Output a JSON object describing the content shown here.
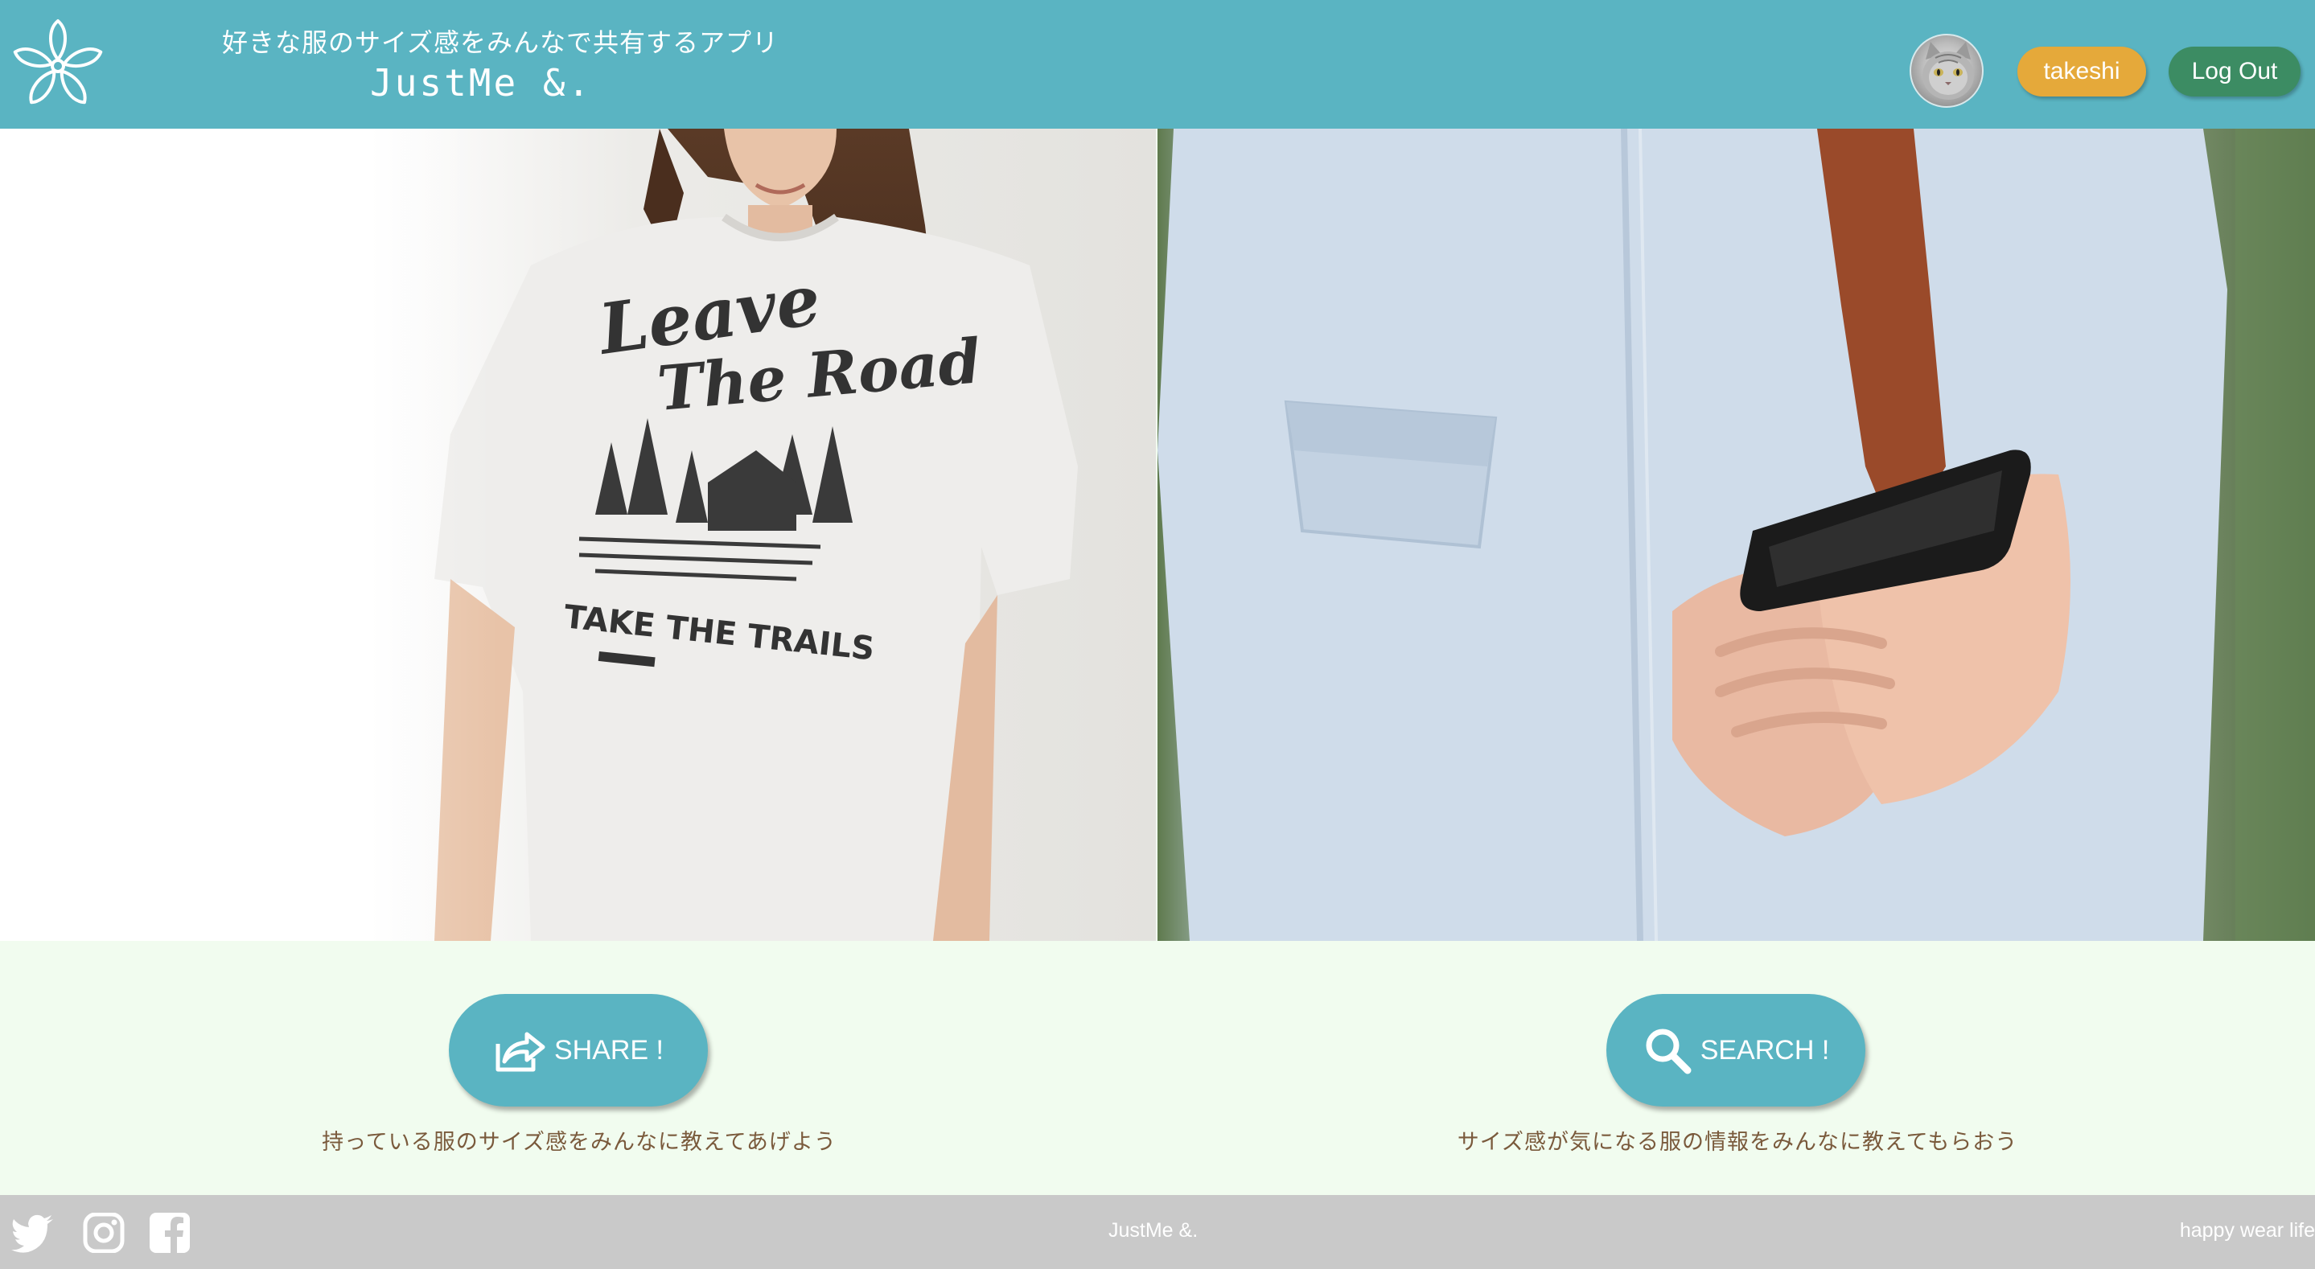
{
  "header": {
    "tagline": "好きな服のサイズ感をみんなで共有するアプリ",
    "title": "JustMe &.",
    "user_label": "takeshi",
    "logout_label": "Log Out",
    "logo_icon": "flower-logo-icon",
    "avatar_icon": "cat-avatar"
  },
  "hero": {
    "left_image": "woman-in-tshirt-photo",
    "left_shirt_lines": [
      "Leave",
      "The Road",
      "TAKE THE TRAILS"
    ],
    "right_image": "woman-holding-smartphone-photo"
  },
  "actions": {
    "share": {
      "label": "SHARE !",
      "icon": "share-arrow-icon",
      "caption": "持っている服のサイズ感をみんなに教えてあげよう"
    },
    "search": {
      "label": "SEARCH !",
      "icon": "search-icon",
      "caption": "サイズ感が気になる服の情報をみんなに教えてもらおう"
    }
  },
  "footer": {
    "brand": "JustMe &.",
    "slogan": "happy wear life",
    "social_icons": [
      "twitter-icon",
      "instagram-icon",
      "facebook-icon"
    ]
  },
  "colors": {
    "header_bg": "#5ab4c2",
    "accent_orange": "#e5a93a",
    "accent_green": "#3c8c63",
    "section_bg": "#f1fcef",
    "footer_bg": "#c9c9c9",
    "caption_text": "#7a5a3c"
  }
}
